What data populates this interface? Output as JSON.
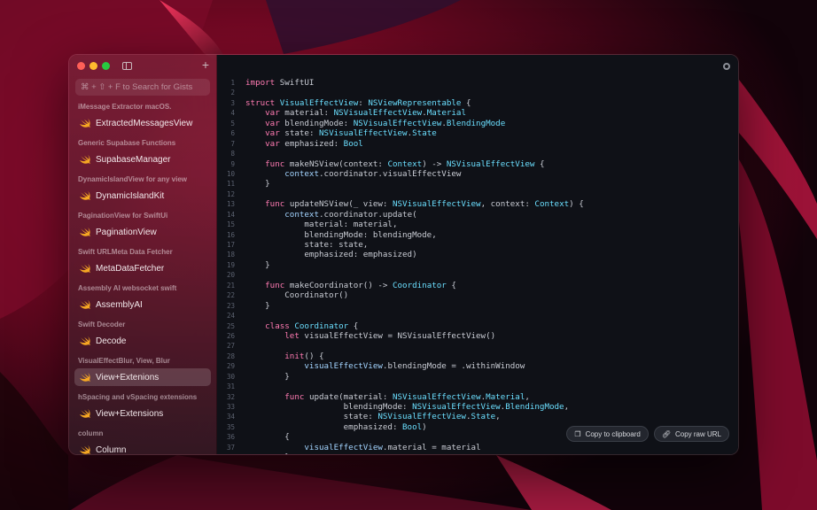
{
  "sidebar": {
    "search_placeholder": "⌘ + ⇧ + F to Search for Gists",
    "groups": [
      {
        "title": "iMessage Extractor macOS.",
        "item": "ExtractedMessagesView"
      },
      {
        "title": "Generic Supabase Functions",
        "item": "SupabaseManager"
      },
      {
        "title": "DynamicIslandView for any view",
        "item": "DynamicIslandKit"
      },
      {
        "title": "PaginationView for SwiftUi",
        "item": "PaginationView"
      },
      {
        "title": "Swift URLMeta Data Fetcher",
        "item": "MetaDataFetcher"
      },
      {
        "title": "Assembly AI websocket swift",
        "item": "AssemblyAI"
      },
      {
        "title": "Swift Decoder",
        "item": "Decode"
      },
      {
        "title": "VisualEffectBlur, View, Blur",
        "item": "View+Extenions"
      },
      {
        "title": "hSpacing and vSpacing extensions",
        "item": "View+Extensions"
      },
      {
        "title": "column",
        "item": "Column"
      }
    ],
    "selected_index": 7
  },
  "editor": {
    "lines": [
      [
        [
          "kw",
          "import"
        ],
        [
          "t",
          " SwiftUI"
        ]
      ],
      [],
      [
        [
          "kw",
          "struct"
        ],
        [
          "t",
          " "
        ],
        [
          "ty",
          "VisualEffectView"
        ],
        [
          "t",
          ": "
        ],
        [
          "ty",
          "NSViewRepresentable"
        ],
        [
          "t",
          " {"
        ]
      ],
      [
        [
          "t",
          "    "
        ],
        [
          "kw",
          "var"
        ],
        [
          "t",
          " material: "
        ],
        [
          "ty",
          "NSVisualEffectView"
        ],
        [
          "t",
          "."
        ],
        [
          "ty",
          "Material"
        ]
      ],
      [
        [
          "t",
          "    "
        ],
        [
          "kw",
          "var"
        ],
        [
          "t",
          " blendingMode: "
        ],
        [
          "ty",
          "NSVisualEffectView"
        ],
        [
          "t",
          "."
        ],
        [
          "ty",
          "BlendingMode"
        ]
      ],
      [
        [
          "t",
          "    "
        ],
        [
          "kw",
          "var"
        ],
        [
          "t",
          " state: "
        ],
        [
          "ty",
          "NSVisualEffectView"
        ],
        [
          "t",
          "."
        ],
        [
          "ty",
          "State"
        ]
      ],
      [
        [
          "t",
          "    "
        ],
        [
          "kw",
          "var"
        ],
        [
          "t",
          " emphasized: "
        ],
        [
          "ty",
          "Bool"
        ]
      ],
      [],
      [
        [
          "t",
          "    "
        ],
        [
          "kw",
          "func"
        ],
        [
          "t",
          " makeNSView(context: "
        ],
        [
          "ty",
          "Context"
        ],
        [
          "t",
          ") -> "
        ],
        [
          "ty",
          "NSVisualEffectView"
        ],
        [
          "t",
          " {"
        ]
      ],
      [
        [
          "t",
          "        "
        ],
        [
          "pr",
          "context"
        ],
        [
          "t",
          ".coordinator.visualEffectView"
        ]
      ],
      [
        [
          "t",
          "    }"
        ]
      ],
      [],
      [
        [
          "t",
          "    "
        ],
        [
          "kw",
          "func"
        ],
        [
          "t",
          " updateNSView(_ view: "
        ],
        [
          "ty",
          "NSVisualEffectView"
        ],
        [
          "t",
          ", context: "
        ],
        [
          "ty",
          "Context"
        ],
        [
          "t",
          ") {"
        ]
      ],
      [
        [
          "t",
          "        "
        ],
        [
          "pr",
          "context"
        ],
        [
          "t",
          ".coordinator.update("
        ]
      ],
      [
        [
          "t",
          "            material: material,"
        ]
      ],
      [
        [
          "t",
          "            blendingMode: blendingMode,"
        ]
      ],
      [
        [
          "t",
          "            state: state,"
        ]
      ],
      [
        [
          "t",
          "            emphasized: emphasized)"
        ]
      ],
      [
        [
          "t",
          "    }"
        ]
      ],
      [],
      [
        [
          "t",
          "    "
        ],
        [
          "kw",
          "func"
        ],
        [
          "t",
          " makeCoordinator() -> "
        ],
        [
          "ty",
          "Coordinator"
        ],
        [
          "t",
          " {"
        ]
      ],
      [
        [
          "t",
          "        Coordinator()"
        ]
      ],
      [
        [
          "t",
          "    }"
        ]
      ],
      [],
      [
        [
          "t",
          "    "
        ],
        [
          "kw",
          "class"
        ],
        [
          "t",
          " "
        ],
        [
          "ty",
          "Coordinator"
        ],
        [
          "t",
          " {"
        ]
      ],
      [
        [
          "t",
          "        "
        ],
        [
          "kw",
          "let"
        ],
        [
          "t",
          " visualEffectView = NSVisualEffectView()"
        ]
      ],
      [],
      [
        [
          "t",
          "        "
        ],
        [
          "kw",
          "init"
        ],
        [
          "t",
          "() {"
        ]
      ],
      [
        [
          "t",
          "            "
        ],
        [
          "pr",
          "visualEffectView"
        ],
        [
          "t",
          ".blendingMode = .withinWindow"
        ]
      ],
      [
        [
          "t",
          "        }"
        ]
      ],
      [],
      [
        [
          "t",
          "        "
        ],
        [
          "kw",
          "func"
        ],
        [
          "t",
          " update(material: "
        ],
        [
          "ty",
          "NSVisualEffectView"
        ],
        [
          "t",
          "."
        ],
        [
          "ty",
          "Material"
        ],
        [
          "t",
          ","
        ]
      ],
      [
        [
          "t",
          "                    blendingMode: "
        ],
        [
          "ty",
          "NSVisualEffectView"
        ],
        [
          "t",
          "."
        ],
        [
          "ty",
          "BlendingMode"
        ],
        [
          "t",
          ","
        ]
      ],
      [
        [
          "t",
          "                    state: "
        ],
        [
          "ty",
          "NSVisualEffectView"
        ],
        [
          "t",
          "."
        ],
        [
          "ty",
          "State"
        ],
        [
          "t",
          ","
        ]
      ],
      [
        [
          "t",
          "                    emphasized: "
        ],
        [
          "ty",
          "Bool"
        ],
        [
          "t",
          ")"
        ]
      ],
      [
        [
          "t",
          "        {"
        ]
      ],
      [
        [
          "t",
          "            "
        ],
        [
          "pr",
          "visualEffectView"
        ],
        [
          "t",
          ".material = material"
        ]
      ],
      [
        [
          "t",
          "        }"
        ]
      ]
    ],
    "copy_clipboard_label": "Copy to clipboard",
    "copy_url_label": "Copy raw URL"
  },
  "colors": {
    "keyword": "#ff7ab2",
    "type": "#6bdfff",
    "swift_icon": "#f5a623"
  },
  "icons": {
    "close": "traffic-close-icon",
    "minimize": "traffic-minimize-icon",
    "maximize": "traffic-maximize-icon",
    "sidebar_toggle": "sidebar-toggle-icon",
    "add": "plus-icon",
    "settings": "settings-icon",
    "clipboard": "clipboard-icon",
    "link": "link-icon",
    "swift": "swift-icon"
  }
}
